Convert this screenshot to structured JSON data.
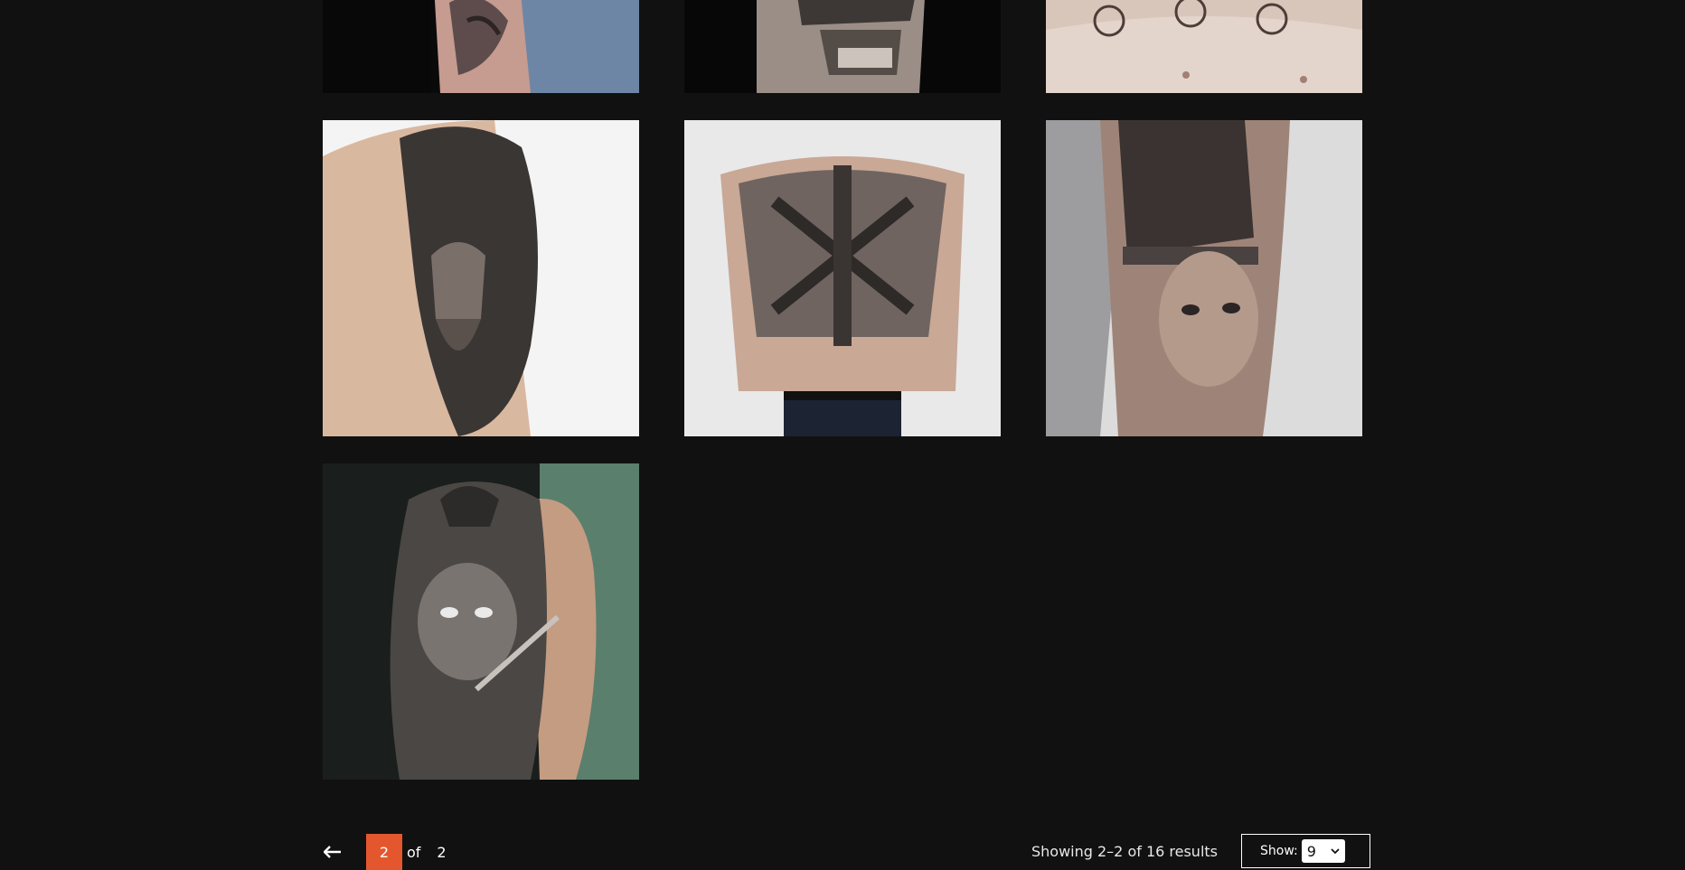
{
  "gallery": {
    "items": [
      {
        "name": "forearm-tattoo-photo",
        "bg": "#cfa8a0"
      },
      {
        "name": "revolver-tattoo-photo",
        "bg": "#6b625c"
      },
      {
        "name": "chest-knot-tattoo-photo",
        "bg": "#d7c3b7"
      },
      {
        "name": "warrior-shoulder-tattoo-photo",
        "bg": "#dcc0ab"
      },
      {
        "name": "viking-back-tattoo-photo",
        "bg": "#cfb5a6"
      },
      {
        "name": "woman-portrait-tattoo-photo",
        "bg": "#b9a89c"
      },
      {
        "name": "samurai-sleeve-tattoo-photo",
        "bg": "#5e6a63"
      }
    ]
  },
  "pagination": {
    "prev_icon": "arrow-left-icon",
    "current_page": "2",
    "of_label": "of",
    "total_pages": "2"
  },
  "results": {
    "text": "Showing 2–2 of 16 results"
  },
  "show": {
    "label": "Show:",
    "value": "9",
    "icon": "chevron-down-icon"
  },
  "colors": {
    "background": "#111111",
    "accent": "#e4572e",
    "text": "#ffffff"
  }
}
